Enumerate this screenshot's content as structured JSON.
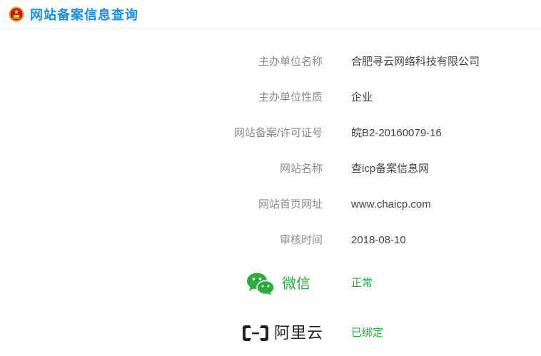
{
  "header": {
    "title": "网站备案信息查询",
    "emblem_icon": "national-emblem-icon"
  },
  "records": [
    {
      "label": "主办单位名称",
      "value": "合肥寻云网络科技有限公司"
    },
    {
      "label": "主办单位性质",
      "value": "企业"
    },
    {
      "label": "网站备案/许可证号",
      "value": "皖B2-20160079-16"
    },
    {
      "label": "网站名称",
      "value": "查icp备案信息网"
    },
    {
      "label": "网站首页网址",
      "value": "www.chaicp.com"
    },
    {
      "label": "审核时间",
      "value": "2018-08-10"
    }
  ],
  "checks": {
    "wechat": {
      "name": "微信",
      "status": "正常",
      "icon": "wechat-icon"
    },
    "aliyun": {
      "name": "阿里云",
      "status": "已绑定",
      "icon": "aliyun-icon"
    }
  },
  "colors": {
    "title": "#1a8fe3",
    "label": "#8a8a8a",
    "value": "#444444",
    "status": "#2eaa3f",
    "divider": "#e6e6e6"
  }
}
